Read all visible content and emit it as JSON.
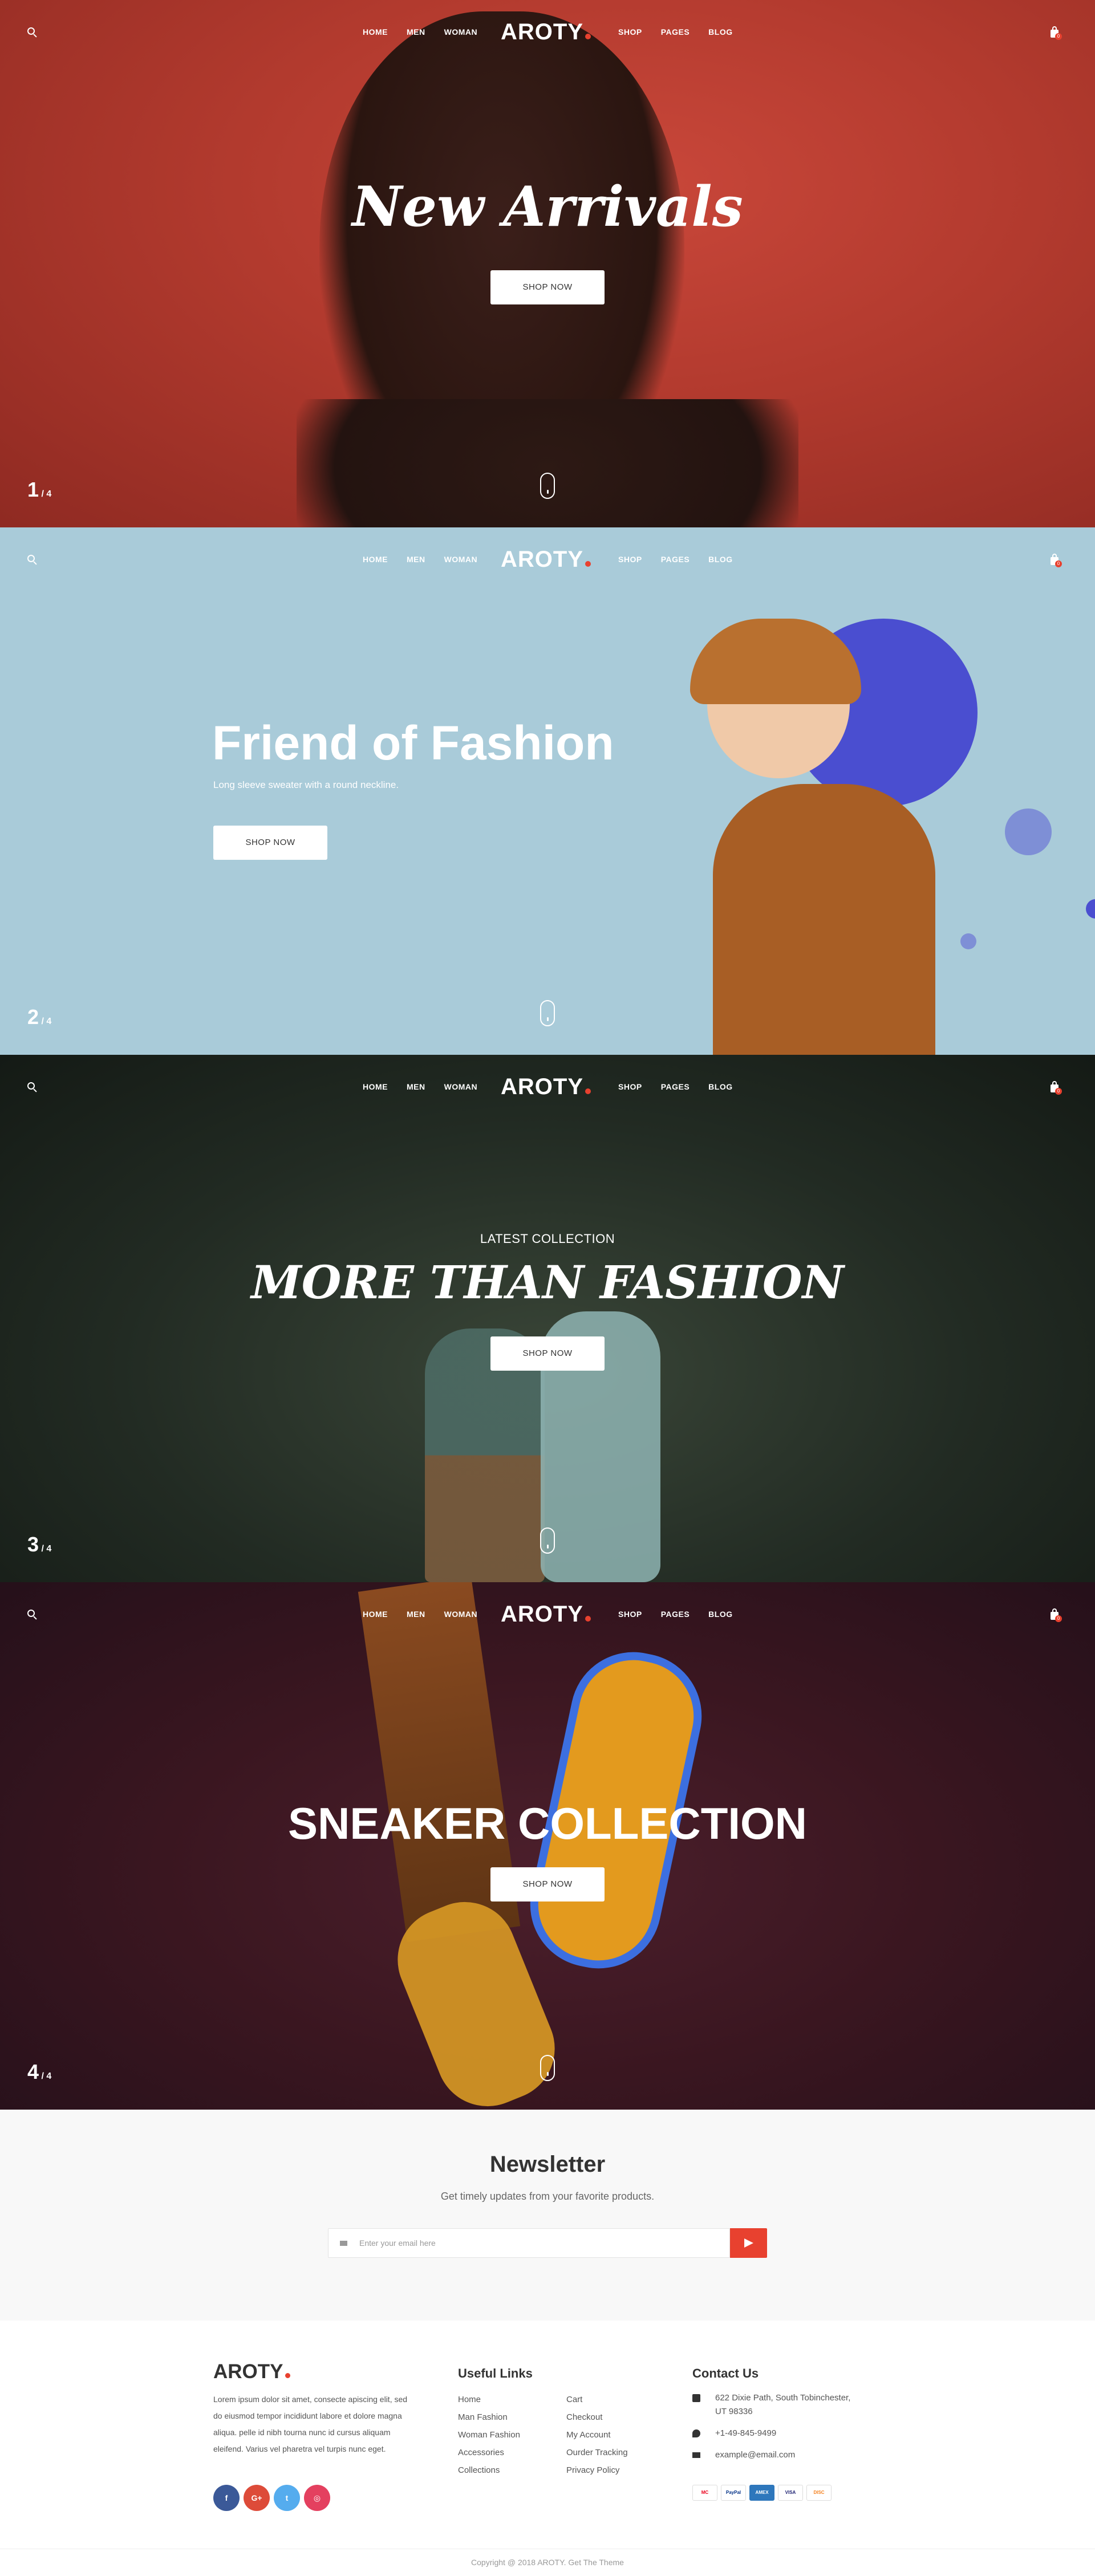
{
  "header": {
    "logo": "AROTY",
    "nav_left": [
      "HOME",
      "MEN",
      "WOMAN"
    ],
    "nav_right": [
      "SHOP",
      "PAGES",
      "BLOG"
    ],
    "cart_count": "0"
  },
  "slides": [
    {
      "counter": "1",
      "total": "/ 4",
      "title": "New Arrivals",
      "button": "SHOP NOW"
    },
    {
      "counter": "2",
      "total": "/ 4",
      "title": "Friend of Fashion",
      "subtitle": "Long sleeve sweater with a round neckline.",
      "button": "SHOP NOW"
    },
    {
      "counter": "3",
      "total": "/ 4",
      "subtitle": "LATEST COLLECTION",
      "title": "MORE THAN FASHION",
      "button": "SHOP NOW"
    },
    {
      "counter": "4",
      "total": "/ 4",
      "title": "SNEAKER COLLECTION",
      "button": "SHOP NOW"
    }
  ],
  "newsletter": {
    "title": "Newsletter",
    "subtitle": "Get timely updates from your favorite products.",
    "placeholder": "Enter your email here"
  },
  "footer": {
    "logo": "AROTY",
    "about": "Lorem ipsum dolor sit amet, consecte apiscing elit, sed do eiusmod tempor incididunt labore et dolore magna aliqua. pelle id nibh tourna nunc id cursus aliquam eleifend. Varius vel pharetra vel turpis nunc eget.",
    "socials": [
      "f",
      "G+",
      "t",
      "◎"
    ],
    "useful_links_title": "Useful Links",
    "links_col1": [
      "Home",
      "Man Fashion",
      "Woman Fashion",
      "Accessories",
      "Collections"
    ],
    "links_col2": [
      "Cart",
      "Checkout",
      "My Account",
      "Ourder Tracking",
      "Privacy Policy"
    ],
    "contact_title": "Contact Us",
    "address": "622 Dixie Path, South Tobinchester, UT 98336",
    "phone": "+1-49-845-9499",
    "email": "example@email.com",
    "payments": [
      "MC",
      "PayPal",
      "AMEX",
      "VISA",
      "DISC"
    ],
    "copyright": "Copyright @ 2018 AROTY. Get The Theme"
  },
  "colors": {
    "accent": "#e8412f",
    "slide1": "#b23a2e",
    "slide2": "#a9cbd9",
    "slide3": "#222b23",
    "slide4": "#3a1620"
  }
}
